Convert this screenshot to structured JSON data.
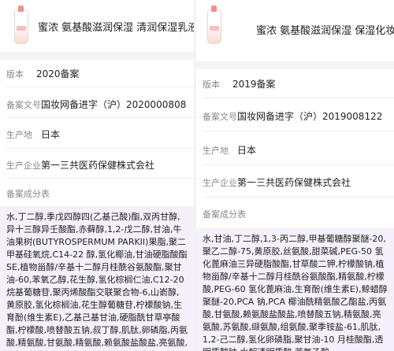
{
  "left": {
    "product_name": "蜜浓 氨基酸滋润保湿 清润保湿乳液",
    "label_filing": "版本",
    "filing": "2020备案",
    "label_record": "备案文号",
    "record_no": "国妆网备进字（沪）2020000808",
    "label_origin": "生产地",
    "origin": "日本",
    "label_maker": "生产企业",
    "maker": "第一三共医药保健株式会社",
    "label_ingredients": "备案成分表",
    "ingredients": "水,丁二醇,季戊四醇四(乙基己酸)酯,双丙甘醇,异十三醇异壬酸酯,赤藓醇,1,2-戊二醇,甘油,牛油果树(BUTYROSPERMUM PARKII)果脂,聚二甲基硅氧烷,C14-22 醇,氢化椰油,甘油硬脂酸酯 SE,植物甾醇/辛基十二醇月桂酰谷氨酸酯,聚甘油-60,苯氧乙醇,花生醇,氢化棕榈仁油,C12-20 烷基葡糖苷,聚丙烯酸酯交联聚合物-6,山嵛醇,黄原胶,氢化棕榈油,花生醇葡糖苷,柠檬酸钠,生育酚(维生素E),乙基己基甘油,硬脂酰甘草亭酸酯,柠檬酸,喷替酸五钠,叔丁醇,肌肽,卵磷脂,丙氨酸,精氨酸,甘氨酸,精氨酸,赖氨酸盐酸盐,亮氨酸,丝氨酸,苏氨酸,缬氨酸,组氨酸,聚季铵盐-61,1,2-己二醇,氢化卵磷脂,聚甘油-10 月桂酸酯"
  },
  "right": {
    "product_name": "蜜浓 氨基酸滋润保湿 保湿化妆水 II",
    "label_filing": "版本",
    "filing": "2019备案",
    "label_record": "备案文号",
    "record_no": "国妆网备进字（沪）2019008122",
    "label_origin": "生产地",
    "origin": "日本",
    "label_maker": "生产企业",
    "maker": "第一三共医药保健株式会社",
    "label_ingredients": "备案成分表",
    "ingredients": "水,甘油,丁二醇,1,3-丙二醇,甲基葡糖醇聚醚-20,聚乙二醇-75,黄原胶,丝氨酸,甜菜碱,PEG-50 氢化蓖麻油三异硬脂酸酯,甘草酸二钾,柠檬酸钠,植物甾醇/辛基十二醇月桂酰谷氨酸酯,精氨酸,柠檬酸,PEG-60 氢化蓖麻油,生育酚(维生素E),鲸蜡醇聚醚-20,PCA 钠,PCA 椰油酰精氨酸乙酯盐,丙氨酸,甘氨酸,赖氨酸盐酸盐,喷替酸五钠,精氨酸,亮氨酸,苏氨酸,缬氨酸,组氨酸,聚季铵盐-61,肌肽,1,2-己二醇,氢化卵磷脂,聚甘油-10 月桂酸酯,透明质酸钠,水解透明质酸,苯氧乙醇"
  }
}
